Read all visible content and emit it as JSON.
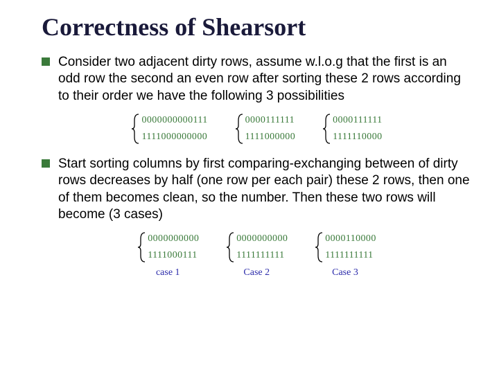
{
  "title": "Correctness of Shearsort",
  "bullets": [
    "Consider two adjacent dirty rows, assume w.l.o.g that the first is an odd row the second an even row after sorting these 2 rows according to their order we have the following 3 possibilities",
    "Start sorting columns by first comparing-exchanging between of dirty rows decreases by half (one row per each pair) these 2 rows, then one of them becomes clean, so the number. Then these two rows will become (3 cases)"
  ],
  "figure1": [
    {
      "top": "0000000000111",
      "bottom": "1111000000000"
    },
    {
      "top": "0000111111",
      "bottom": "1111000000"
    },
    {
      "top": "0000111111",
      "bottom": "1111110000"
    }
  ],
  "figure2": [
    {
      "top": "0000000000",
      "bottom": "1111000111",
      "label": "case 1"
    },
    {
      "top": "0000000000",
      "bottom": "1111111111",
      "label": "Case 2"
    },
    {
      "top": "0000110000",
      "bottom": "1111111111",
      "label": "Case 3"
    }
  ],
  "colors": {
    "bullet": "#3a7a3a",
    "caseLabel": "#2a2aaa"
  }
}
